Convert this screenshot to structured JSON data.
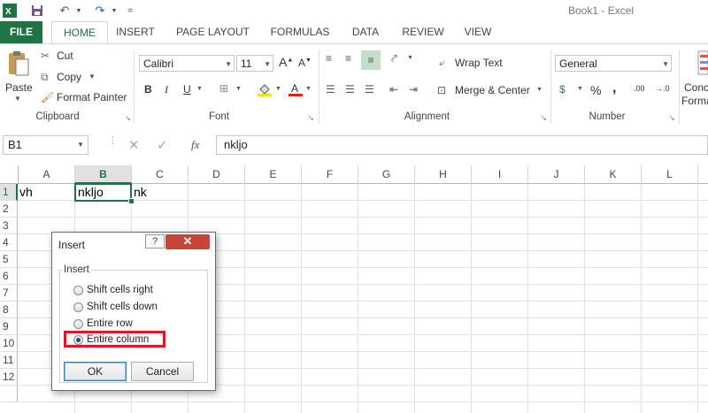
{
  "window": {
    "title": "Book1 - Excel"
  },
  "tabs": [
    "FILE",
    "HOME",
    "INSERT",
    "PAGE LAYOUT",
    "FORMULAS",
    "DATA",
    "REVIEW",
    "VIEW"
  ],
  "ribbon": {
    "clipboard": {
      "paste": "Paste",
      "cut": "Cut",
      "copy": "Copy",
      "format_painter": "Format Painter",
      "label": "Clipboard"
    },
    "font": {
      "name": "Calibri",
      "size": "11",
      "bold": "B",
      "italic": "I",
      "underline": "U",
      "label": "Font"
    },
    "alignment": {
      "wrap_text": "Wrap Text",
      "merge_center": "Merge & Center",
      "label": "Alignment"
    },
    "number": {
      "format": "General",
      "currency": "$",
      "percent": "%",
      "comma": ",",
      "inc_decimal": ".00",
      "dec_decimal": "→.0",
      "label": "Number"
    },
    "styles": {
      "cond_format_line1": "Conc",
      "cond_format_line2": "Forma"
    }
  },
  "formula_bar": {
    "name_box": "B1",
    "fx": "fx",
    "value": "nkljo"
  },
  "grid": {
    "columns": [
      "A",
      "B",
      "C",
      "D",
      "E",
      "F",
      "G",
      "H",
      "I",
      "J",
      "K",
      "L"
    ],
    "rows": [
      "1",
      "2",
      "3",
      "4",
      "5",
      "6",
      "7",
      "8",
      "9",
      "10",
      "11",
      "12"
    ],
    "selected_column": "B",
    "selected_row": "1",
    "cells": {
      "A1": "vh",
      "B1": "nkljo",
      "C1": "nk"
    }
  },
  "dialog": {
    "title": "Insert",
    "help": "?",
    "close": "✕",
    "group_label": "Insert",
    "options": [
      "Shift cells right",
      "Shift cells down",
      "Entire row",
      "Entire column"
    ],
    "selected_option": "Entire column",
    "ok": "OK",
    "cancel": "Cancel"
  },
  "colors": {
    "excel_green": "#217346",
    "highlight_red": "#e5141e",
    "close_red": "#c7443b"
  }
}
